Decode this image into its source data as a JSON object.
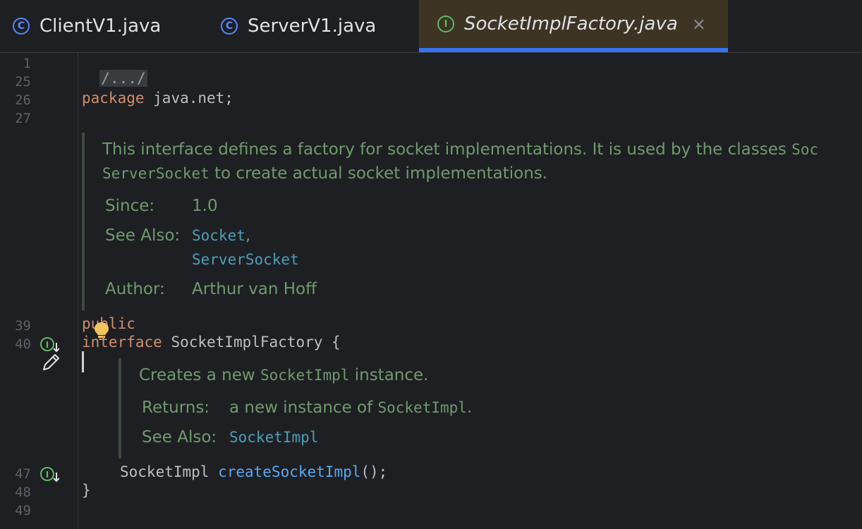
{
  "tabs": [
    {
      "label": "ClientV1.java",
      "icon": "class-icon",
      "icon_glyph": "C",
      "active": false
    },
    {
      "label": "ServerV1.java",
      "icon": "class-icon",
      "icon_glyph": "C",
      "active": false
    },
    {
      "label": "SocketImplFactory.java",
      "icon": "interface-icon",
      "icon_glyph": "I",
      "active": true,
      "close": "×"
    }
  ],
  "line_numbers": [
    "1",
    "25",
    "26",
    "27",
    "39",
    "40",
    "47",
    "48",
    "49"
  ],
  "code": {
    "fold": "/.../",
    "package_kw": "package",
    "package_name": " java.net;",
    "public_kw": "public",
    "interface_kw": "interface",
    "interface_decl": " SocketImplFactory {",
    "method_type": "SocketImpl ",
    "method_name": "createSocketImpl",
    "method_tail": "();",
    "close_brace": "}"
  },
  "doc1": {
    "line1_text": "This interface defines a factory for socket implementations. It is used by the classes ",
    "line1_code": "Soc",
    "line2_code": "ServerSocket",
    "line2_text": " to create actual socket implementations.",
    "since_label": "Since:",
    "since_value": "1.0",
    "see_also_label": "See Also:",
    "see_also_link1": "Socket",
    "see_also_sep": ",",
    "see_also_link2": "ServerSocket",
    "author_label": "Author:",
    "author_value": "Arthur van Hoff"
  },
  "doc2": {
    "line1_pre": "Creates a new ",
    "line1_code": "SocketImpl",
    "line1_post": " instance.",
    "returns_label": "Returns:",
    "returns_pre": "a new instance of ",
    "returns_code": "SocketImpl",
    "returns_post": ".",
    "see_also_label": "See Also:",
    "see_also_link": "SocketImpl"
  },
  "colors": {
    "accent": "#3574f0",
    "keyword": "#cf8e6d",
    "method": "#56a8f5",
    "doc_text": "#6f9a6f",
    "doc_link": "#4a9fba",
    "interface_icon": "#5fb865",
    "class_icon": "#548af7"
  }
}
